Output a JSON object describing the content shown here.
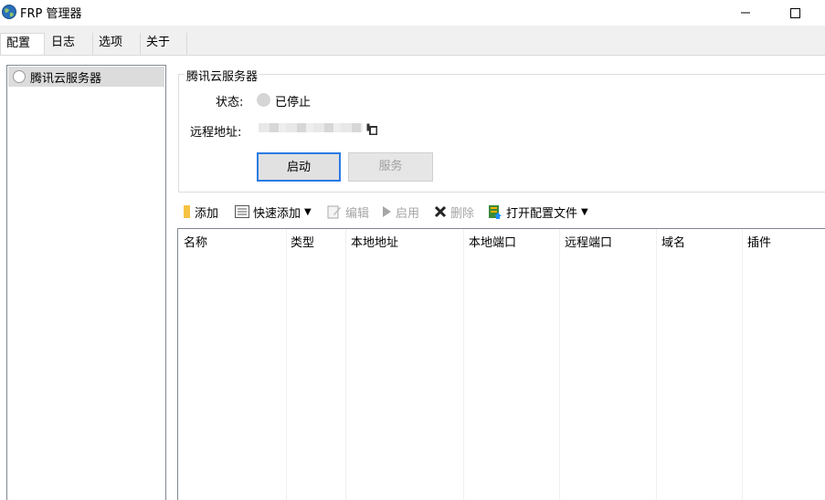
{
  "window": {
    "title": "FRP 管理器"
  },
  "tabs": [
    {
      "label": "配置"
    },
    {
      "label": "日志"
    },
    {
      "label": "选项"
    },
    {
      "label": "关于"
    }
  ],
  "config_list": [
    {
      "label": "腾讯云服务器"
    }
  ],
  "details": {
    "group_title": "腾讯云服务器",
    "status_label": "状态:",
    "status_value": "已停止",
    "address_label": "远程地址:"
  },
  "buttons": {
    "start": "启动",
    "service": "服务"
  },
  "toolbar": {
    "add": "添加",
    "quick_add": "快速添加",
    "edit": "编辑",
    "enable": "启用",
    "delete": "删除",
    "open_config": "打开配置文件"
  },
  "table": {
    "columns": [
      "名称",
      "类型",
      "本地地址",
      "本地端口",
      "远程端口",
      "域名",
      "插件"
    ]
  }
}
